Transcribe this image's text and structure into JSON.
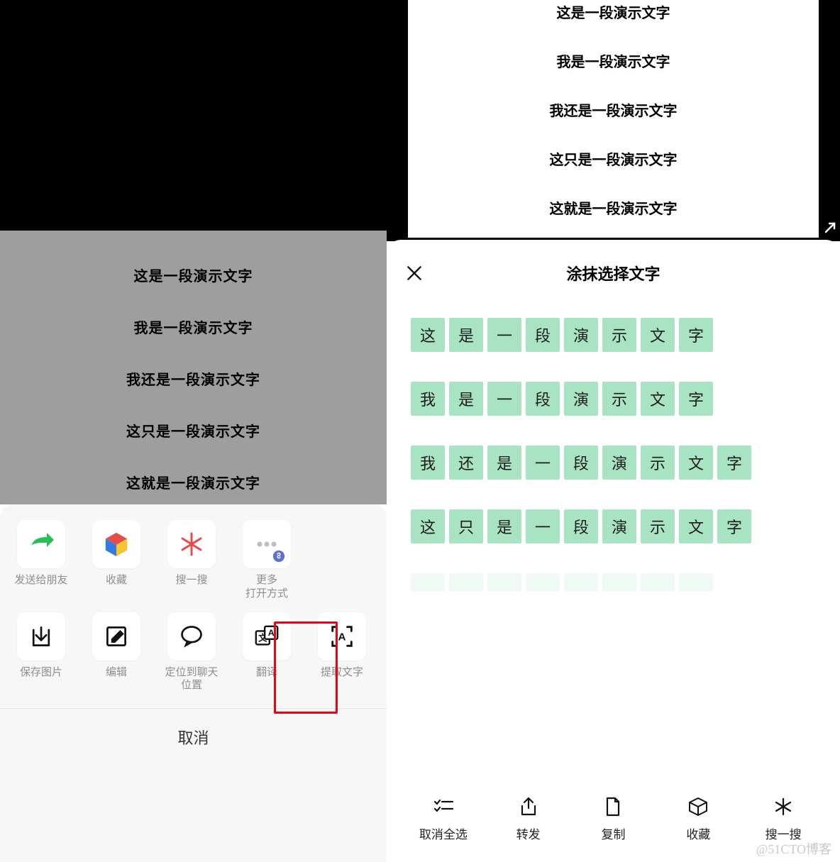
{
  "left": {
    "demo_lines": [
      "这是一段演示文字",
      "我是一段演示文字",
      "我还是一段演示文字",
      "这只是一段演示文字",
      "这就是一段演示文字"
    ],
    "sheet": {
      "row1": [
        {
          "name": "send-to-friends",
          "label": "发送给朋友"
        },
        {
          "name": "favorite",
          "label": "收藏"
        },
        {
          "name": "search",
          "label": "搜一搜"
        },
        {
          "name": "more-open-with",
          "label": "更多\n打开方式"
        }
      ],
      "row2": [
        {
          "name": "save-image",
          "label": "保存图片"
        },
        {
          "name": "edit",
          "label": "编辑"
        },
        {
          "name": "locate-in-chat",
          "label": "定位到聊天\n位置"
        },
        {
          "name": "translate",
          "label": "翻译"
        },
        {
          "name": "extract-text",
          "label": "提取文字"
        }
      ],
      "cancel": "取消"
    }
  },
  "right": {
    "demo_lines": [
      "这是一段演示文字",
      "我是一段演示文字",
      "我还是一段演示文字",
      "这只是一段演示文字",
      "这就是一段演示文字"
    ],
    "panel": {
      "title": "涂抹选择文字",
      "rows": [
        [
          "这",
          "是",
          "一",
          "段",
          "演",
          "示",
          "文",
          "字"
        ],
        [
          "我",
          "是",
          "一",
          "段",
          "演",
          "示",
          "文",
          "字"
        ],
        [
          "我",
          "还",
          "是",
          "一",
          "段",
          "演",
          "示",
          "文",
          "字"
        ],
        [
          "这",
          "只",
          "是",
          "一",
          "段",
          "演",
          "示",
          "文",
          "字"
        ]
      ],
      "actions": [
        {
          "name": "deselect-all",
          "label": "取消全选"
        },
        {
          "name": "forward",
          "label": "转发"
        },
        {
          "name": "copy",
          "label": "复制"
        },
        {
          "name": "favorite",
          "label": "收藏"
        },
        {
          "name": "search",
          "label": "搜一搜"
        }
      ]
    }
  },
  "watermark": "@51CTO博客"
}
